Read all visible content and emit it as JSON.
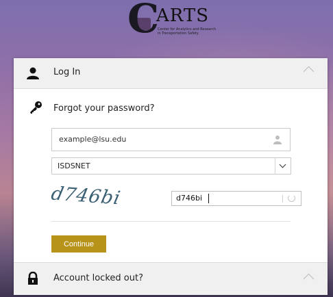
{
  "logo": {
    "letter": "C",
    "text": "ARTS",
    "tagline": "Center for Analytics and Research in Transportation Safety"
  },
  "login": {
    "title": "Log In"
  },
  "forgot": {
    "label": "Forgot your password?"
  },
  "email": {
    "value": "example@lsu.edu"
  },
  "domain_select": {
    "value": "ISDSNET"
  },
  "captcha": {
    "image_text": "d746bi",
    "input_value": "d746bi"
  },
  "continue_button": {
    "label": "Continue"
  },
  "locked": {
    "title": "Account locked out?"
  },
  "colors": {
    "accent": "#b8931a",
    "header_bg": "#f0f0f0"
  }
}
